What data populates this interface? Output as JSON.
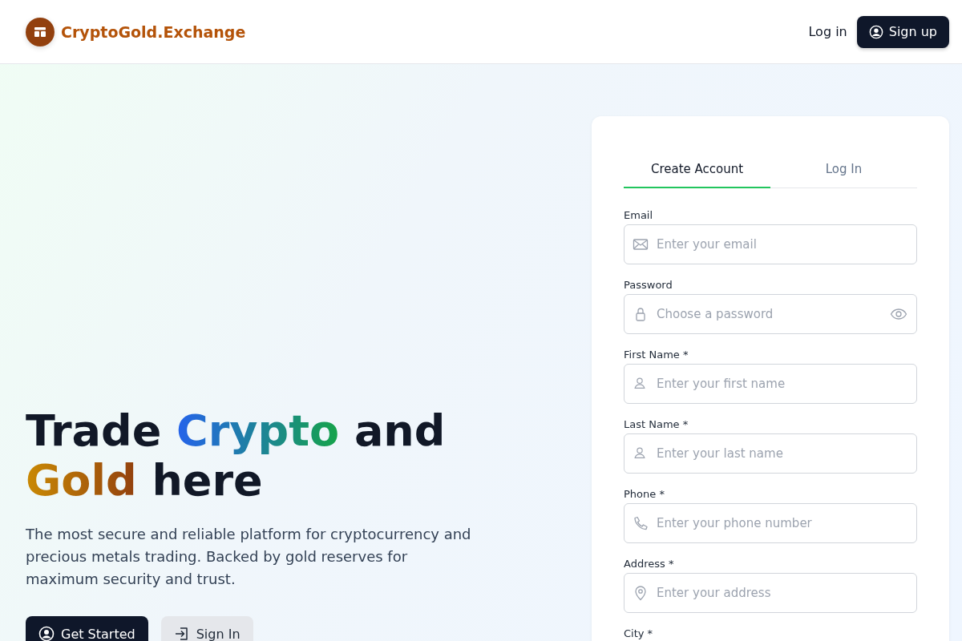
{
  "header": {
    "brand": "CryptoGold.Exchange",
    "login": "Log in",
    "signup": "Sign up"
  },
  "hero": {
    "headline": [
      {
        "text": "Trade ",
        "kind": "plain"
      },
      {
        "text": "Crypto",
        "kind": "crypto"
      },
      {
        "text": " and ",
        "kind": "plain"
      },
      {
        "text": "Gold",
        "kind": "gold"
      },
      {
        "text": " here",
        "kind": "plain"
      }
    ],
    "subtitle": "The most secure and reliable platform for cryptocurrency and precious metals trading. Backed by gold reserves for maximum security and trust.",
    "buttons": [
      {
        "label": "Get Started",
        "kind": "primary"
      },
      {
        "label": "Sign In",
        "kind": "secondary"
      }
    ]
  },
  "form": {
    "tabs": [
      {
        "label": "Create Account",
        "selected": true
      },
      {
        "label": "Log In",
        "selected": false
      }
    ],
    "fields": [
      {
        "label": "Email",
        "placeholder": "Enter your email",
        "kind": "email"
      },
      {
        "label": "Password",
        "placeholder": "Choose a password",
        "kind": "password",
        "reveal": true
      },
      {
        "label": "First Name *",
        "placeholder": "Enter your first name",
        "kind": "name"
      },
      {
        "label": "Last Name *",
        "placeholder": "Enter your last name",
        "kind": "name"
      },
      {
        "label": "Phone *",
        "placeholder": "Enter your phone number",
        "kind": "phone"
      },
      {
        "label": "Address *",
        "placeholder": "Enter your address",
        "kind": "address"
      },
      {
        "label": "City *",
        "kind": "city"
      }
    ]
  }
}
